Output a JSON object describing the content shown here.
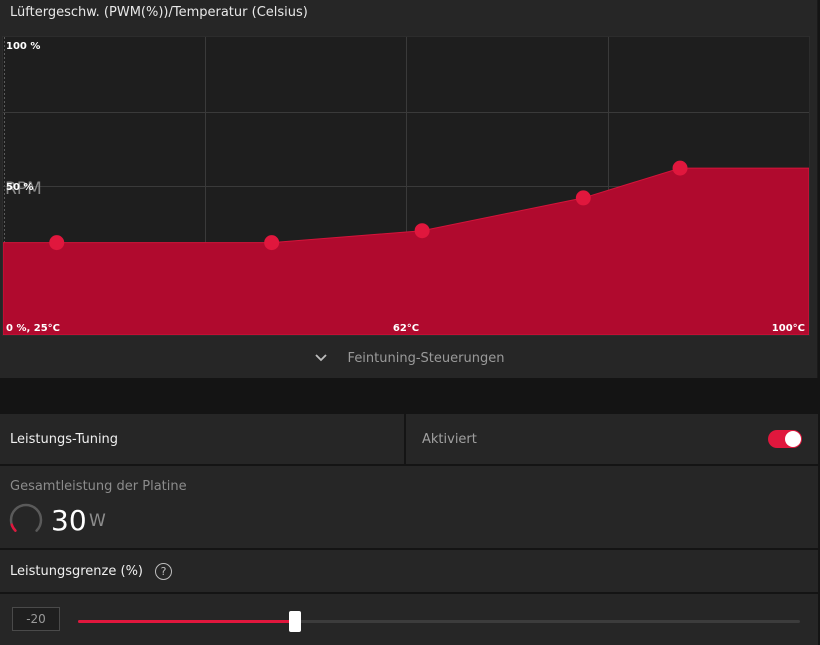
{
  "fan_panel": {
    "title": "Lüftergeschw. (PWM(%))/Temperatur (Celsius)",
    "fine_tune_label": "Feintuning-Steuerungen",
    "fine_tune_icon": "chevron-down-icon"
  },
  "chart_data": {
    "type": "area",
    "y_top_label": "100 %",
    "y_mid_label": "50 %",
    "overlay_text": "RPM",
    "x_left_label": "0 %, 25°C",
    "x_mid_label": "62°C",
    "x_right_label": "100°C",
    "xlim": [
      25,
      100
    ],
    "ylim": [
      0,
      100
    ],
    "grid": true,
    "points": [
      {
        "x": 30,
        "y": 31
      },
      {
        "x": 50,
        "y": 31
      },
      {
        "x": 64,
        "y": 35
      },
      {
        "x": 79,
        "y": 46
      },
      {
        "x": 88,
        "y": 56
      }
    ],
    "fill_color": "#b00a2e",
    "point_color": "#e0173d"
  },
  "performance_tuning": {
    "label": "Leistungs-Tuning",
    "status_label": "Aktiviert",
    "enabled": true,
    "toggle_color": "#e0173d"
  },
  "board_power": {
    "label": "Gesamtleistung der Platine",
    "value": "30",
    "unit": "W",
    "gauge_fraction": 0.1
  },
  "power_limit": {
    "label": "Leistungsgrenze (%)",
    "help_icon": "help-circle-icon",
    "help_glyph": "?",
    "value": "-20",
    "min": -50,
    "max": 50,
    "current": -20
  }
}
